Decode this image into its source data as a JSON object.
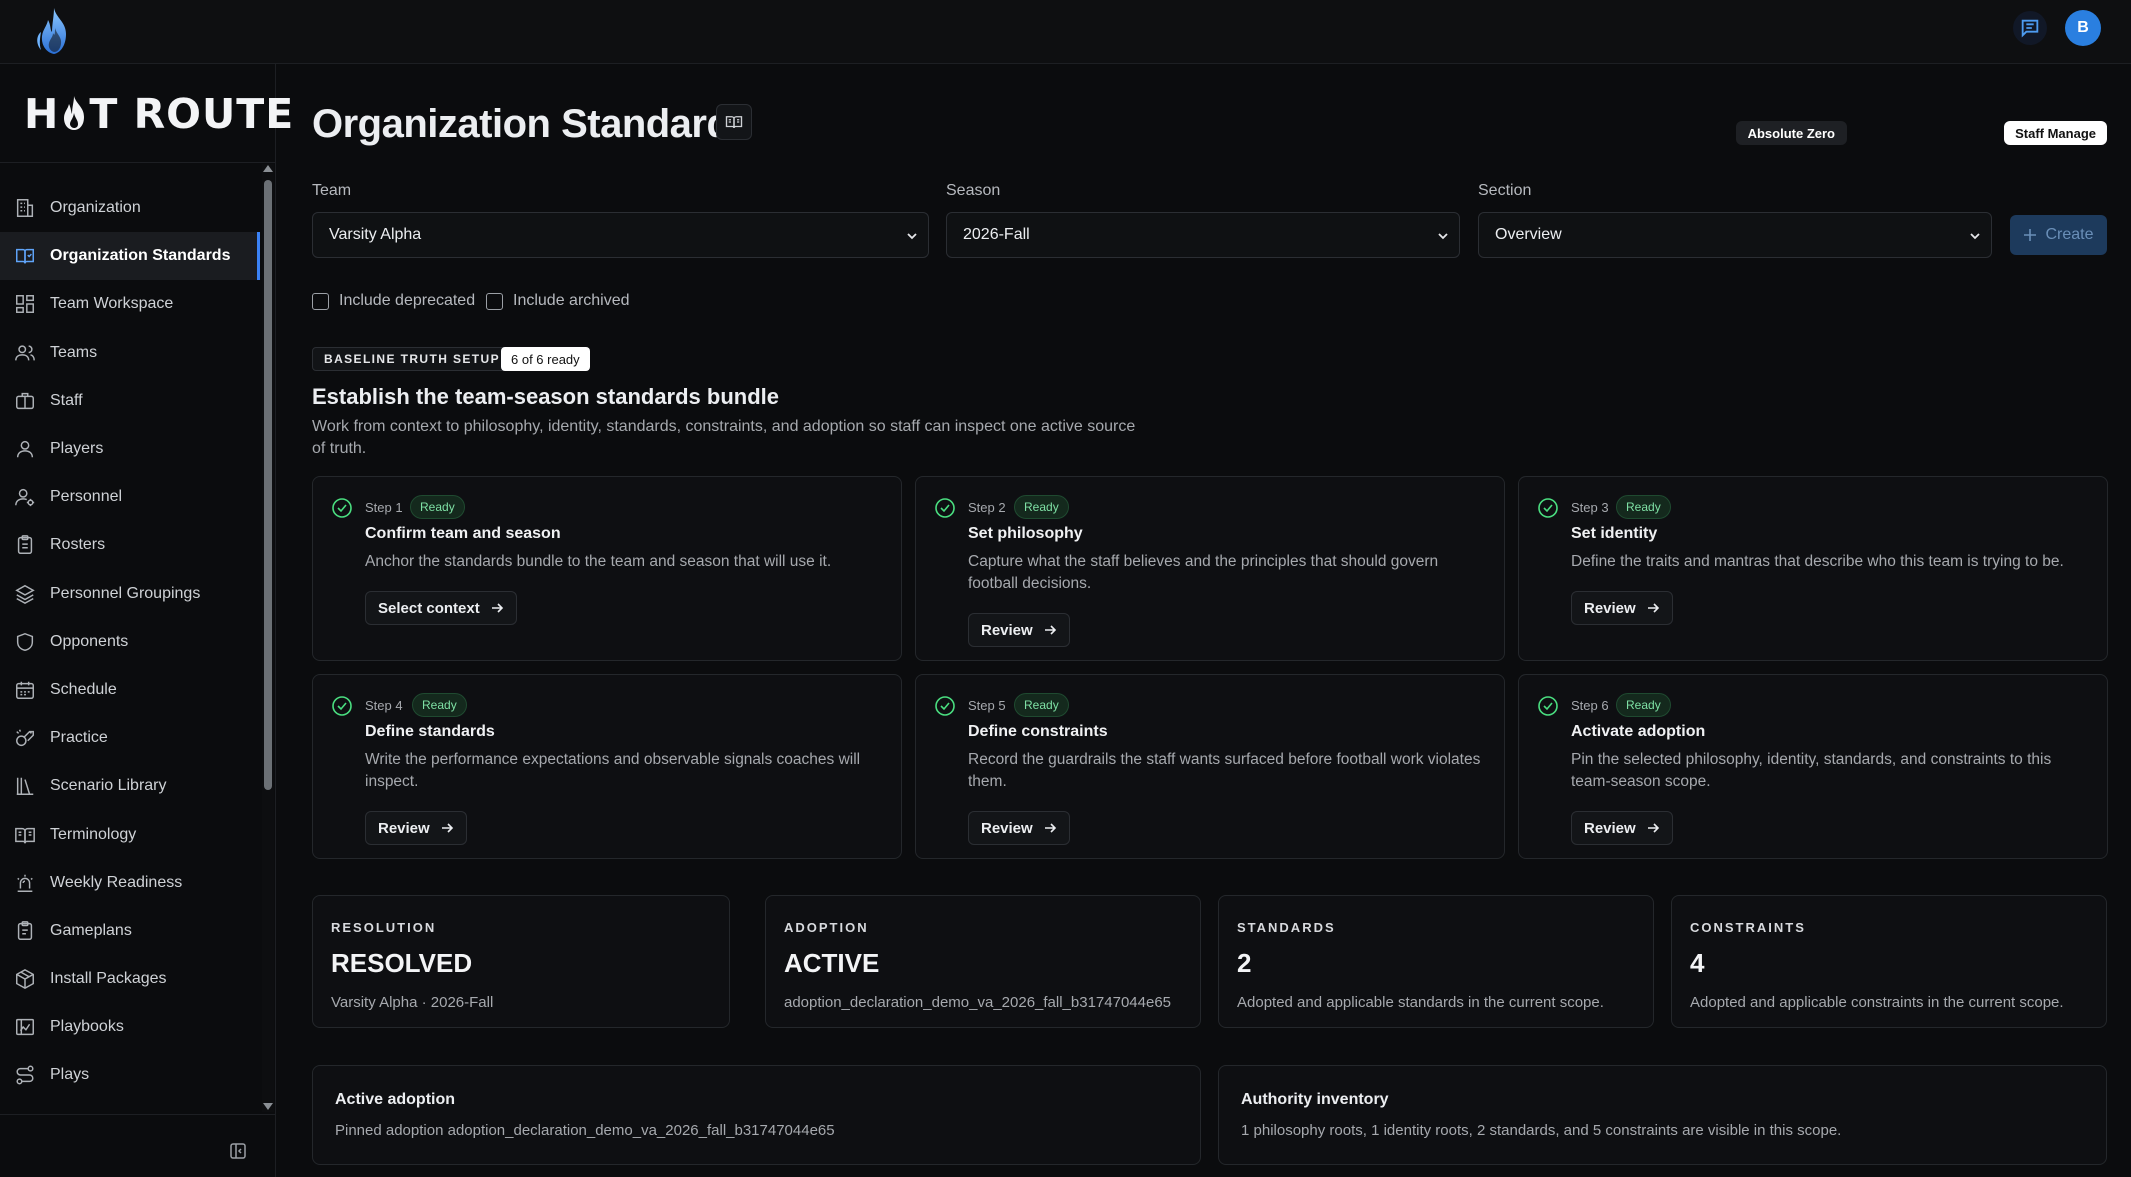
{
  "app": {
    "brand": "H T ROUTE",
    "brand_left": "H",
    "brand_right": "T ROUTE",
    "user_initial": "B"
  },
  "sidebar": {
    "items": [
      {
        "label": "Organization",
        "icon": "building-icon"
      },
      {
        "label": "Organization Standards",
        "icon": "book-check-icon",
        "active": true
      },
      {
        "label": "Team Workspace",
        "icon": "layout-grid-icon"
      },
      {
        "label": "Teams",
        "icon": "users-icon"
      },
      {
        "label": "Staff",
        "icon": "briefcase-icon"
      },
      {
        "label": "Players",
        "icon": "user-icon"
      },
      {
        "label": "Personnel",
        "icon": "user-cog-icon"
      },
      {
        "label": "Rosters",
        "icon": "clipboard-list-icon"
      },
      {
        "label": "Personnel Groupings",
        "icon": "layers-icon"
      },
      {
        "label": "Opponents",
        "icon": "shield-icon"
      },
      {
        "label": "Schedule",
        "icon": "calendar-icon"
      },
      {
        "label": "Practice",
        "icon": "whistle-icon"
      },
      {
        "label": "Scenario Library",
        "icon": "library-icon"
      },
      {
        "label": "Terminology",
        "icon": "open-book-icon"
      },
      {
        "label": "Weekly Readiness",
        "icon": "siren-icon"
      },
      {
        "label": "Gameplans",
        "icon": "clipboard-icon"
      },
      {
        "label": "Install Packages",
        "icon": "package-icon"
      },
      {
        "label": "Playbooks",
        "icon": "playbook-icon"
      },
      {
        "label": "Plays",
        "icon": "route-icon"
      }
    ]
  },
  "header": {
    "title": "Organization Standards",
    "tag_org": "Absolute Zero",
    "tag_role": "Staff Manage"
  },
  "filters": {
    "team_label": "Team",
    "team_value": "Varsity Alpha",
    "season_label": "Season",
    "season_value": "2026-Fall",
    "section_label": "Section",
    "section_value": "Overview",
    "create_label": "Create",
    "include_deprecated": "Include deprecated",
    "include_archived": "Include archived"
  },
  "setup": {
    "badge": "BASELINE TRUTH SETUP",
    "progress": "6 of 6 ready",
    "title": "Establish the team-season standards bundle",
    "description": "Work from context to philosophy, identity, standards, constraints, and adoption so staff can inspect one active source of truth.",
    "steps": [
      {
        "step": "Step 1",
        "status": "Ready",
        "title": "Confirm team and season",
        "desc": "Anchor the standards bundle to the team and season that will use it.",
        "action": "Select context"
      },
      {
        "step": "Step 2",
        "status": "Ready",
        "title": "Set philosophy",
        "desc": "Capture what the staff believes and the principles that should govern football decisions.",
        "action": "Review"
      },
      {
        "step": "Step 3",
        "status": "Ready",
        "title": "Set identity",
        "desc": "Define the traits and mantras that describe who this team is trying to be.",
        "action": "Review"
      },
      {
        "step": "Step 4",
        "status": "Ready",
        "title": "Define standards",
        "desc": "Write the performance expectations and observable signals coaches will inspect.",
        "action": "Review"
      },
      {
        "step": "Step 5",
        "status": "Ready",
        "title": "Define constraints",
        "desc": "Record the guardrails the staff wants surfaced before football work violates them.",
        "action": "Review"
      },
      {
        "step": "Step 6",
        "status": "Ready",
        "title": "Activate adoption",
        "desc": "Pin the selected philosophy, identity, standards, and constraints to this team-season scope.",
        "action": "Review"
      }
    ]
  },
  "stats": [
    {
      "label": "RESOLUTION",
      "value": "RESOLVED",
      "sub": "Varsity Alpha · 2026-Fall"
    },
    {
      "label": "ADOPTION",
      "value": "ACTIVE",
      "sub": "adoption_declaration_demo_va_2026_fall_b31747044e65"
    },
    {
      "label": "STANDARDS",
      "value": "2",
      "sub": "Adopted and applicable standards in the current scope."
    },
    {
      "label": "CONSTRAINTS",
      "value": "4",
      "sub": "Adopted and applicable constraints in the current scope."
    }
  ],
  "info": [
    {
      "title": "Active adoption",
      "value": "Pinned adoption adoption_declaration_demo_va_2026_fall_b31747044e65"
    },
    {
      "title": "Authority inventory",
      "value": "1 philosophy roots, 1 identity roots, 2 standards, and 5 constraints are visible in this scope."
    }
  ],
  "colors": {
    "accent": "#3b82f6",
    "ready_text": "#7ee0a4",
    "ready_bg": "#14291d",
    "background": "#0b0c0e"
  }
}
